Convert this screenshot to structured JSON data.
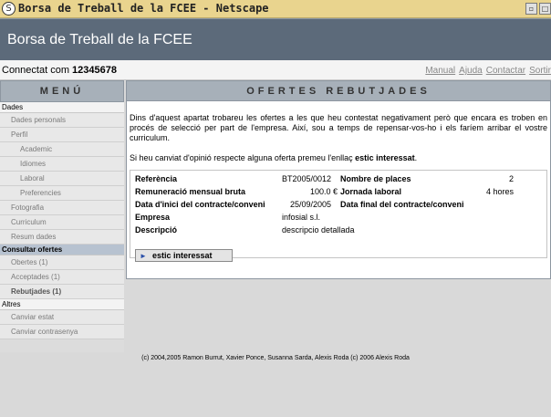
{
  "window": {
    "title": "Borsa de Treball de la FCEE - Netscape"
  },
  "header": {
    "site_title": "Borsa de Treball de la FCEE"
  },
  "infobar": {
    "connected_prefix": "Connectat com",
    "user_id": "12345678",
    "links": [
      "Manual",
      "Ajuda",
      "Contactar",
      "Sortir"
    ]
  },
  "sidebar": {
    "title": "MENÚ",
    "dades": {
      "label": "Dades",
      "items": [
        "Dades personals",
        "Perfil"
      ],
      "perfil_sub": [
        "Academic",
        "Idiomes",
        "Laboral",
        "Preferencies"
      ],
      "items2": [
        "Fotografia",
        "Curriculum",
        "Resum dades"
      ]
    },
    "consultar": {
      "label": "Consultar ofertes",
      "items": [
        "Obertes (1)",
        "Acceptades (1)",
        "Rebutjades (1)"
      ]
    },
    "altres": {
      "label": "Altres",
      "items": [
        "Canviar estat",
        "Canviar contrasenya"
      ]
    }
  },
  "main": {
    "title": "OFERTES REBUTJADES",
    "intro": "Dins d'aquest apartat trobareu les ofertes a les que heu contestat negativament però que encara es troben en procés de selecció per part de l'empresa. Així, sou a temps de repensar-vos-ho i els faríem arribar el vostre curriculum.",
    "note_prefix": "Si heu canviat d'opinió respecte alguna oferta premeu l'enllaç",
    "note_link": "estic interessat",
    "note_suffix": "."
  },
  "offer": {
    "ref_label": "Referència",
    "ref_value": "BT2005/0012",
    "places_label": "Nombre de places",
    "places_value": "2",
    "salary_label": "Remuneració mensual bruta",
    "salary_value": "100.0 €",
    "hours_label": "Jornada laboral",
    "hours_value": "4 hores",
    "start_label": "Data d'inici del contracte/conveni",
    "start_value": "25/09/2005",
    "end_label": "Data final del contracte/conveni",
    "company_label": "Empresa",
    "company_value": "infosial s.l.",
    "desc_label": "Descripció",
    "desc_value": "descripcio detallada",
    "button_label": "estic interessat"
  },
  "footer": {
    "text": "(c) 2004,2005 Ramon Burrut, Xavier Ponce, Susanna Sarda, Alexis Roda (c) 2006 Alexis Roda"
  }
}
